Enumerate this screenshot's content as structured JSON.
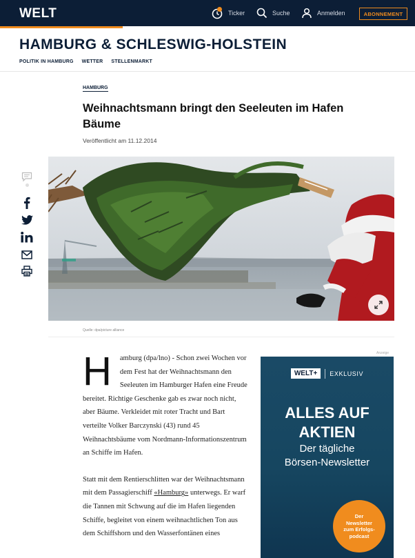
{
  "header": {
    "logo": "WELT",
    "nav": {
      "ticker": "Ticker",
      "search": "Suche",
      "login": "Anmelden",
      "subscribe": "ABONNEMENT"
    },
    "accent_color": "#f08c1e",
    "bar_color": "#0c1e36"
  },
  "section": {
    "title": "HAMBURG & SCHLESWIG-HOLSTEIN",
    "subnav": [
      "POLITIK IN HAMBURG",
      "WETTER",
      "STELLENMARKT"
    ]
  },
  "article": {
    "kicker": "HAMBURG",
    "headline": "Weihnachtsmann bringt den Seeleuten im Hafen Bäume",
    "published": "Veröffentlicht am 11.12.2014",
    "image_credit": "Quelle: dpa/picture alliance",
    "dropcap": "H",
    "paragraph1": "amburg (dpa/lno) - Schon zwei Wochen vor dem Fest hat der Weihnachtsmann den Seeleuten im Hamburger Hafen eine Freude bereitet. Richtige Geschenke gab es zwar noch nicht, aber Bäume. Verkleidet mit roter Tracht und Bart verteilte Volker Barczynski (43) rund 45 Weihnachtsbäume vom Nordmann-Informationszentrum an Schiffe im Hafen.",
    "paragraph2_before": "Statt mit dem Rentierschlitten war der Weihnachtsmann mit dem Passagierschiff ",
    "paragraph2_link": "«Hamburg»",
    "paragraph2_after": " unterwegs. Er warf die Tannen mit Schwung auf die im Hafen liegenden Schiffe, begleitet von einem weihnachtlichen Ton aus dem Schiffshorn und den Wasserfontänen eines"
  },
  "share": {
    "icons": [
      "comment-icon",
      "facebook-icon",
      "twitter-icon",
      "linkedin-icon",
      "mail-icon",
      "print-icon"
    ]
  },
  "ad": {
    "label": "Anzeige",
    "brand": "WELT+",
    "exclusive": "EXKLUSIV",
    "title_line1": "ALLES AUF",
    "title_line2": "AKTIEN",
    "subtitle_line1": "Der tägliche",
    "subtitle_line2": "Börsen-Newsletter",
    "badge_line1": "Der",
    "badge_line2": "Newsletter",
    "badge_line3": "zum Erfolgs-",
    "badge_line4": "podcast"
  }
}
